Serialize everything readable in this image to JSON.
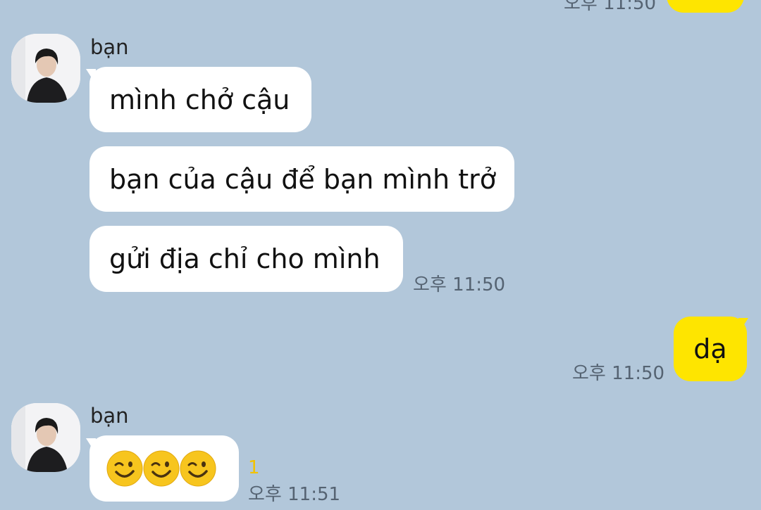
{
  "colors": {
    "background": "#b2c7da",
    "incoming_bubble": "#ffffff",
    "outgoing_bubble": "#fee500",
    "unread_count": "#f2c200",
    "timestamp": "#556372"
  },
  "chat": {
    "top_partial": {
      "time": "오후 11:50"
    },
    "group1": {
      "sender": "bạn",
      "avatar_icon": "profile-photo",
      "messages": [
        "mình chở cậu",
        "bạn của cậu để bạn mình trở",
        "gửi địa chỉ cho mình"
      ],
      "time": "오후 11:50"
    },
    "outgoing1": {
      "text": "dạ",
      "time": "오후 11:50"
    },
    "group2": {
      "sender": "bạn",
      "avatar_icon": "profile-photo",
      "emojis": [
        "winking-face",
        "winking-face",
        "winking-face"
      ],
      "unread": "1",
      "time": "오후 11:51"
    }
  }
}
